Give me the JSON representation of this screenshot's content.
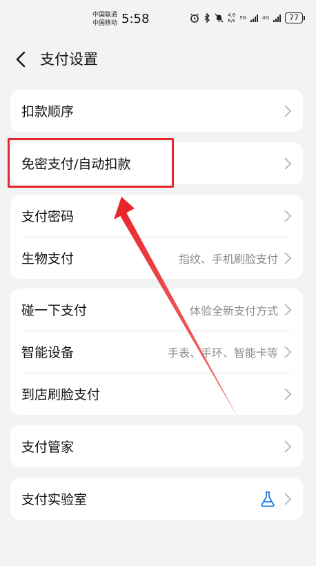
{
  "status_bar": {
    "carrier1": "中国联通",
    "carrier2": "中国移动",
    "time": "5:58",
    "speed_value": "4.6",
    "speed_unit": "K/s",
    "net1": "5G",
    "net2": "4G",
    "battery": "77",
    "icons": [
      "alarm-icon",
      "bluetooth-icon",
      "mute-icon"
    ]
  },
  "header": {
    "title": "支付设置"
  },
  "groups": [
    {
      "items": [
        {
          "label": "扣款顺序",
          "value": ""
        }
      ]
    },
    {
      "items": [
        {
          "label": "免密支付/自动扣款",
          "value": ""
        }
      ]
    },
    {
      "items": [
        {
          "label": "支付密码",
          "value": ""
        },
        {
          "label": "生物支付",
          "value": "指纹、手机刷脸支付"
        }
      ]
    },
    {
      "items": [
        {
          "label": "碰一下支付",
          "value": "体验全新支付方式"
        },
        {
          "label": "智能设备",
          "value": "手表、手环、智能卡等"
        },
        {
          "label": "到店刷脸支付",
          "value": ""
        }
      ]
    },
    {
      "items": [
        {
          "label": "支付管家",
          "value": ""
        }
      ]
    },
    {
      "items": [
        {
          "label": "支付实验室",
          "value": "",
          "icon": "flask-icon"
        }
      ]
    }
  ],
  "colors": {
    "background": "#f1f3f5",
    "annotation": "#e8262a",
    "accent": "#1f7ae0"
  }
}
